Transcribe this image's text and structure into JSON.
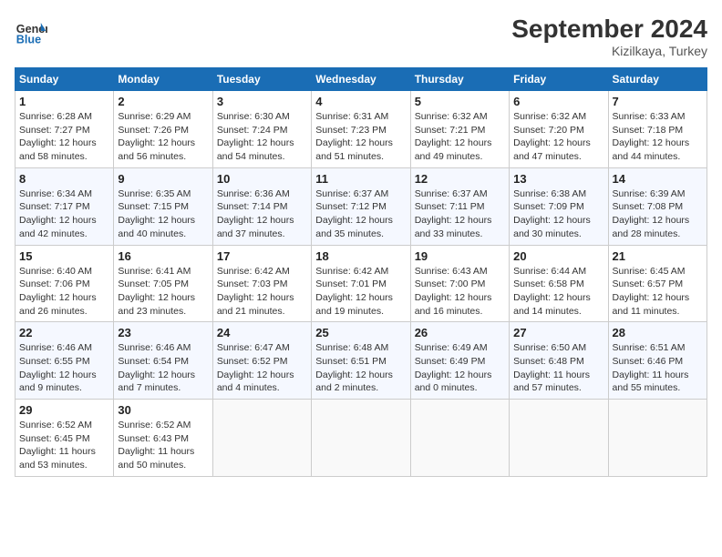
{
  "header": {
    "logo_line1": "General",
    "logo_line2": "Blue",
    "month": "September 2024",
    "location": "Kizilkaya, Turkey"
  },
  "weekdays": [
    "Sunday",
    "Monday",
    "Tuesday",
    "Wednesday",
    "Thursday",
    "Friday",
    "Saturday"
  ],
  "weeks": [
    [
      {
        "day": "1",
        "sunrise": "6:28 AM",
        "sunset": "7:27 PM",
        "daylight": "12 hours and 58 minutes."
      },
      {
        "day": "2",
        "sunrise": "6:29 AM",
        "sunset": "7:26 PM",
        "daylight": "12 hours and 56 minutes."
      },
      {
        "day": "3",
        "sunrise": "6:30 AM",
        "sunset": "7:24 PM",
        "daylight": "12 hours and 54 minutes."
      },
      {
        "day": "4",
        "sunrise": "6:31 AM",
        "sunset": "7:23 PM",
        "daylight": "12 hours and 51 minutes."
      },
      {
        "day": "5",
        "sunrise": "6:32 AM",
        "sunset": "7:21 PM",
        "daylight": "12 hours and 49 minutes."
      },
      {
        "day": "6",
        "sunrise": "6:32 AM",
        "sunset": "7:20 PM",
        "daylight": "12 hours and 47 minutes."
      },
      {
        "day": "7",
        "sunrise": "6:33 AM",
        "sunset": "7:18 PM",
        "daylight": "12 hours and 44 minutes."
      }
    ],
    [
      {
        "day": "8",
        "sunrise": "6:34 AM",
        "sunset": "7:17 PM",
        "daylight": "12 hours and 42 minutes."
      },
      {
        "day": "9",
        "sunrise": "6:35 AM",
        "sunset": "7:15 PM",
        "daylight": "12 hours and 40 minutes."
      },
      {
        "day": "10",
        "sunrise": "6:36 AM",
        "sunset": "7:14 PM",
        "daylight": "12 hours and 37 minutes."
      },
      {
        "day": "11",
        "sunrise": "6:37 AM",
        "sunset": "7:12 PM",
        "daylight": "12 hours and 35 minutes."
      },
      {
        "day": "12",
        "sunrise": "6:37 AM",
        "sunset": "7:11 PM",
        "daylight": "12 hours and 33 minutes."
      },
      {
        "day": "13",
        "sunrise": "6:38 AM",
        "sunset": "7:09 PM",
        "daylight": "12 hours and 30 minutes."
      },
      {
        "day": "14",
        "sunrise": "6:39 AM",
        "sunset": "7:08 PM",
        "daylight": "12 hours and 28 minutes."
      }
    ],
    [
      {
        "day": "15",
        "sunrise": "6:40 AM",
        "sunset": "7:06 PM",
        "daylight": "12 hours and 26 minutes."
      },
      {
        "day": "16",
        "sunrise": "6:41 AM",
        "sunset": "7:05 PM",
        "daylight": "12 hours and 23 minutes."
      },
      {
        "day": "17",
        "sunrise": "6:42 AM",
        "sunset": "7:03 PM",
        "daylight": "12 hours and 21 minutes."
      },
      {
        "day": "18",
        "sunrise": "6:42 AM",
        "sunset": "7:01 PM",
        "daylight": "12 hours and 19 minutes."
      },
      {
        "day": "19",
        "sunrise": "6:43 AM",
        "sunset": "7:00 PM",
        "daylight": "12 hours and 16 minutes."
      },
      {
        "day": "20",
        "sunrise": "6:44 AM",
        "sunset": "6:58 PM",
        "daylight": "12 hours and 14 minutes."
      },
      {
        "day": "21",
        "sunrise": "6:45 AM",
        "sunset": "6:57 PM",
        "daylight": "12 hours and 11 minutes."
      }
    ],
    [
      {
        "day": "22",
        "sunrise": "6:46 AM",
        "sunset": "6:55 PM",
        "daylight": "12 hours and 9 minutes."
      },
      {
        "day": "23",
        "sunrise": "6:46 AM",
        "sunset": "6:54 PM",
        "daylight": "12 hours and 7 minutes."
      },
      {
        "day": "24",
        "sunrise": "6:47 AM",
        "sunset": "6:52 PM",
        "daylight": "12 hours and 4 minutes."
      },
      {
        "day": "25",
        "sunrise": "6:48 AM",
        "sunset": "6:51 PM",
        "daylight": "12 hours and 2 minutes."
      },
      {
        "day": "26",
        "sunrise": "6:49 AM",
        "sunset": "6:49 PM",
        "daylight": "12 hours and 0 minutes."
      },
      {
        "day": "27",
        "sunrise": "6:50 AM",
        "sunset": "6:48 PM",
        "daylight": "11 hours and 57 minutes."
      },
      {
        "day": "28",
        "sunrise": "6:51 AM",
        "sunset": "6:46 PM",
        "daylight": "11 hours and 55 minutes."
      }
    ],
    [
      {
        "day": "29",
        "sunrise": "6:52 AM",
        "sunset": "6:45 PM",
        "daylight": "11 hours and 53 minutes."
      },
      {
        "day": "30",
        "sunrise": "6:52 AM",
        "sunset": "6:43 PM",
        "daylight": "11 hours and 50 minutes."
      },
      null,
      null,
      null,
      null,
      null
    ]
  ]
}
